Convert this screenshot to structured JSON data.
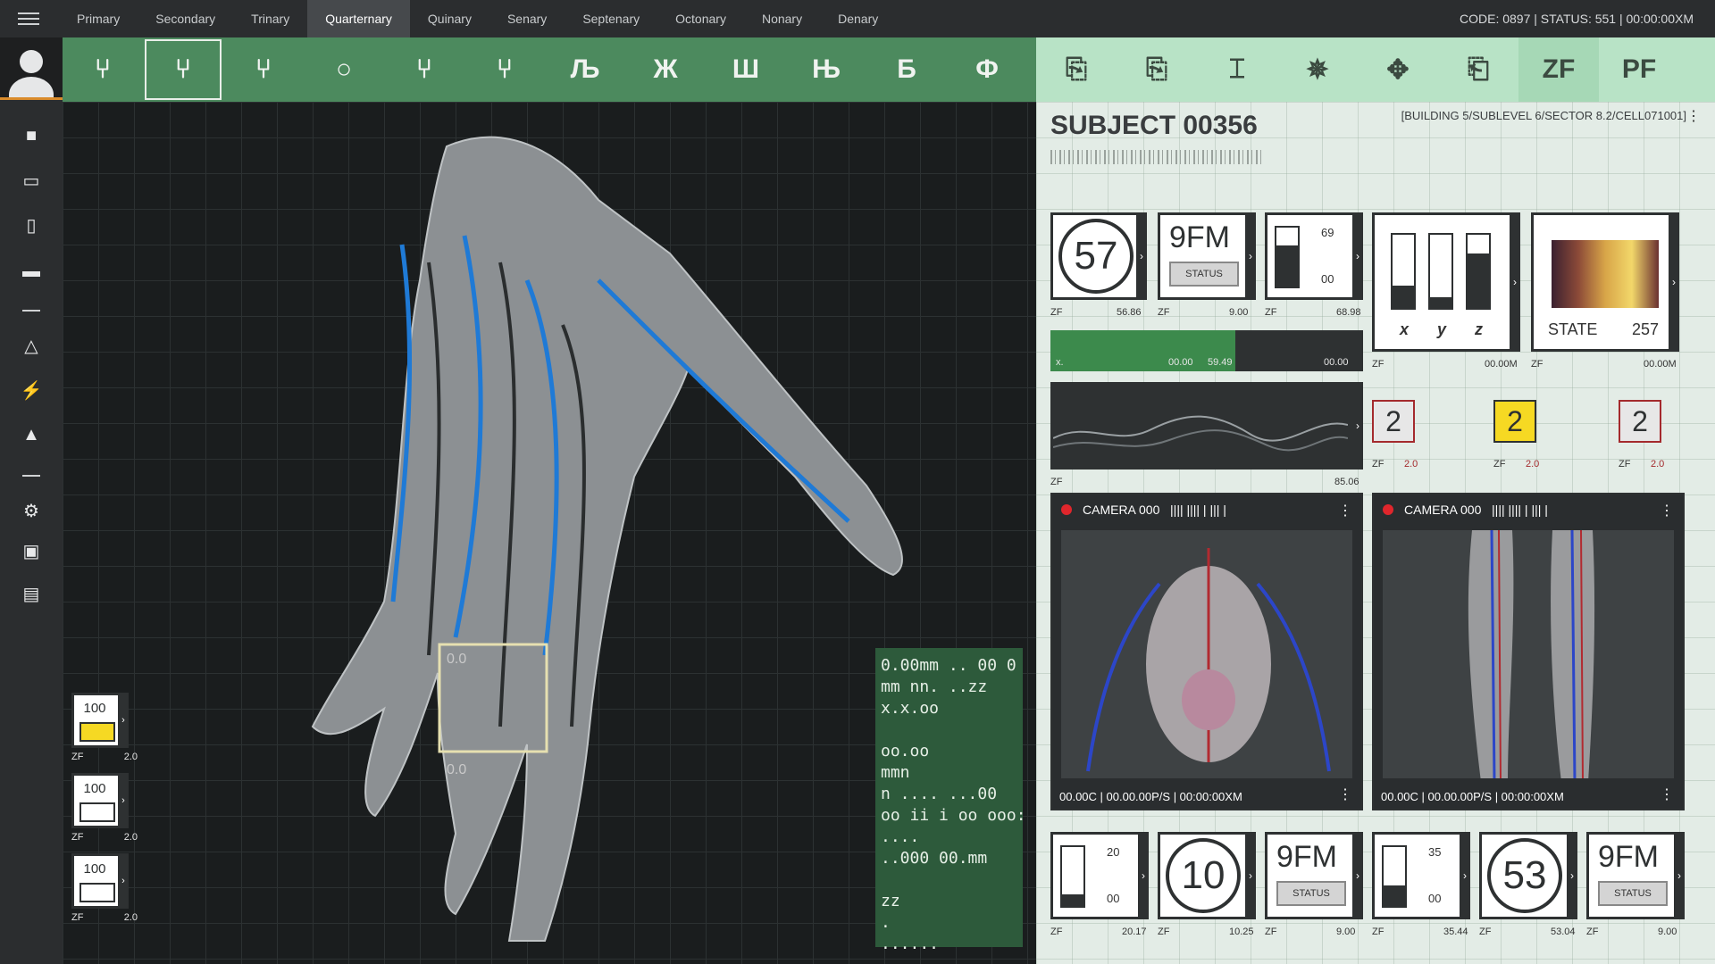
{
  "topbar": {
    "tabs": [
      "Primary",
      "Secondary",
      "Trinary",
      "Quarternary",
      "Quinary",
      "Senary",
      "Septenary",
      "Octonary",
      "Nonary",
      "Denary"
    ],
    "active_tab": "Quarternary",
    "status_text": "CODE: 0897 | STATUS: 551 | 00:00:00XM"
  },
  "toolbar_left": {
    "glyphs": [
      "⑂",
      "⑂",
      "⑂",
      "○",
      "⑂",
      "⑂",
      "Љ",
      "Ж",
      "Ш",
      "Њ",
      "Б",
      "Ф"
    ]
  },
  "toolbar_right": {
    "labels": [
      "⎘",
      "⎘",
      "⌶",
      "✵",
      "✥",
      "⎗",
      "ZF",
      "PF"
    ]
  },
  "subject": {
    "title": "SUBJECT 00356",
    "location": "[BUILDING 5/SUBLEVEL 6/SECTOR 8.2/CELL071001]"
  },
  "row1": {
    "gauge_value": "57",
    "gauge_left": "ZF",
    "gauge_right": "56.86",
    "status_value": "9FM",
    "status_label": "STATUS",
    "status_left": "ZF",
    "status_right": "9.00",
    "bar_top": "69",
    "bar_bottom": "00",
    "bar_left": "ZF",
    "bar_right": "68.98"
  },
  "xyz": {
    "x": "x",
    "y": "y",
    "z": "z",
    "left": "ZF",
    "right": "00.00M"
  },
  "state": {
    "label": "STATE",
    "value": "257",
    "left": "ZF",
    "right": "00.00M"
  },
  "progress": {
    "left_text": "x.",
    "val_a": "00.00",
    "val_b": "59.49",
    "val_c": "00.00",
    "fill_fraction": 0.59
  },
  "wave": {
    "left": "ZF",
    "right": "85.06"
  },
  "tickets": [
    {
      "value": "2",
      "left": "ZF",
      "right": "2.0",
      "style": "grey"
    },
    {
      "value": "2",
      "left": "ZF",
      "right": "2.0",
      "style": "yellow"
    },
    {
      "value": "2",
      "left": "ZF",
      "right": "2.0",
      "style": "grey"
    }
  ],
  "cameras": [
    {
      "title": "CAMERA 000",
      "code": "|||| |||| | |||  |",
      "footer": "00.00C | 00.00.00P/S | 00:00:00XM"
    },
    {
      "title": "CAMERA 000",
      "code": "|||| |||| | |||  |",
      "footer": "00.00C | 00.00.00P/S | 00:00:00XM"
    }
  ],
  "bottom": [
    {
      "kind": "bar",
      "top": "20",
      "bottom": "00",
      "left": "ZF",
      "right": "20.17"
    },
    {
      "kind": "gauge",
      "value": "10",
      "left": "ZF",
      "right": "10.25"
    },
    {
      "kind": "status",
      "value": "9FM",
      "label": "STATUS",
      "left": "ZF",
      "right": "9.00"
    },
    {
      "kind": "bar",
      "top": "35",
      "bottom": "00",
      "left": "ZF",
      "right": "35.44"
    },
    {
      "kind": "gauge",
      "value": "53",
      "left": "ZF",
      "right": "53.04"
    },
    {
      "kind": "status",
      "value": "9FM",
      "label": "STATUS",
      "left": "ZF",
      "right": "9.00"
    }
  ],
  "swatches": [
    {
      "value": "100",
      "color": "#f6d923",
      "left": "ZF",
      "right": "2.0"
    },
    {
      "value": "100",
      "color": "#ffffff",
      "left": "ZF",
      "right": "2.0"
    },
    {
      "value": "100",
      "color": "#ffffff",
      "left": "ZF",
      "right": "2.0"
    }
  ],
  "notes": "0.00mm .. 00 0\nmm nn. ..zz\nx.x.oo\n\noo.oo\nmmn\nn .... ...00\noo ii i oo ooo:\n....\n..000 00.mm\n\nzz\n.\n......",
  "viewport_labels": {
    "a": "0.0",
    "b": "0.0"
  }
}
